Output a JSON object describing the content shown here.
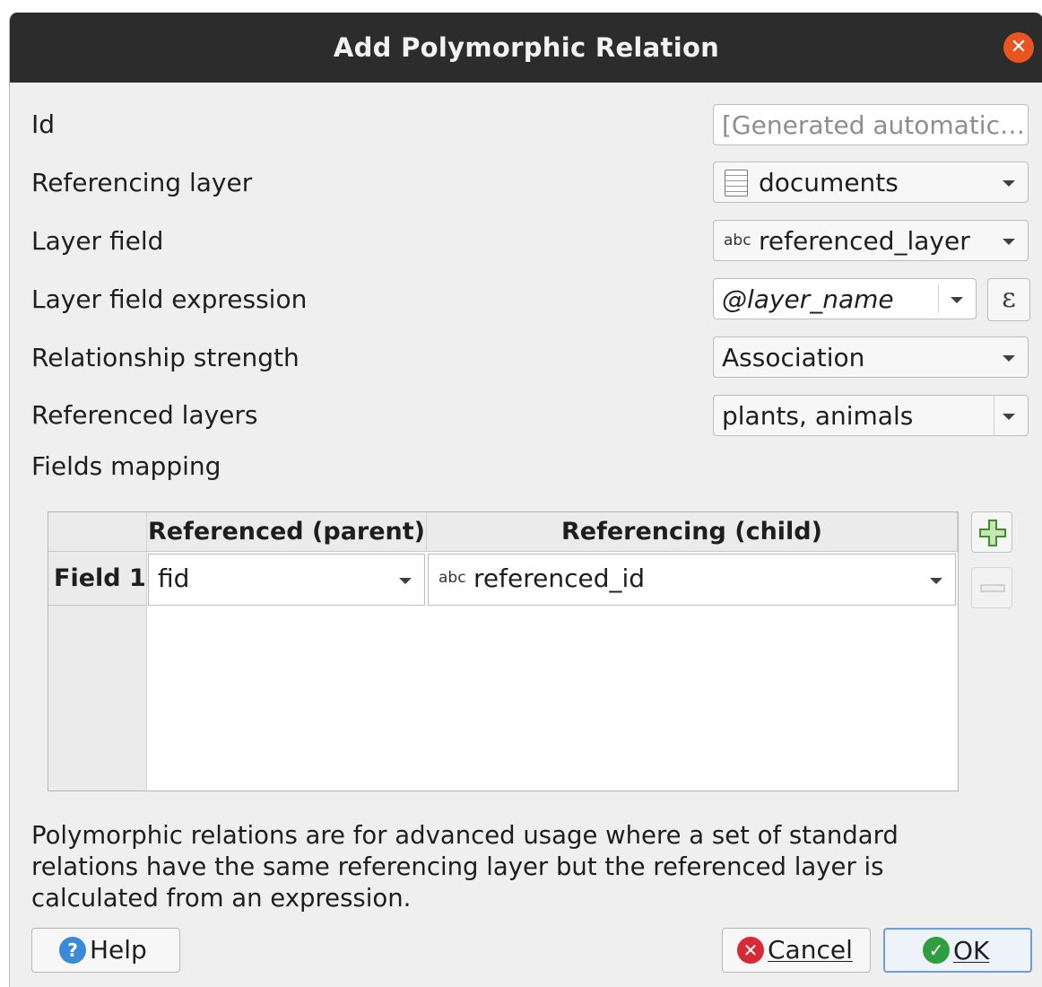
{
  "dialog": {
    "title": "Add Polymorphic Relation",
    "close_icon": "close-icon",
    "accent_color": "#e95420"
  },
  "form": {
    "id_label": "Id",
    "id_placeholder": "[Generated automatic…",
    "referencing_layer_label": "Referencing layer",
    "referencing_layer_value": "documents",
    "layer_field_label": "Layer field",
    "layer_field_type": "abc",
    "layer_field_value": "referenced_layer",
    "layer_field_expression_label": "Layer field expression",
    "layer_field_expression_value": "@layer_name",
    "expression_button_glyph": "ε",
    "relationship_strength_label": "Relationship strength",
    "relationship_strength_value": "Association",
    "referenced_layers_label": "Referenced layers",
    "referenced_layers_value": "plants, animals",
    "fields_mapping_label": "Fields mapping"
  },
  "mapping_table": {
    "columns": [
      "Referenced (parent)",
      "Referencing (child)"
    ],
    "rows": [
      {
        "header": "Field 1",
        "parent": "fid",
        "child_type": "abc",
        "child": "referenced_id"
      }
    ],
    "add_icon": "plus-icon",
    "remove_icon": "minus-icon"
  },
  "description": "Polymorphic relations are for advanced usage where a set of standard relations have the same referencing layer but the referenced layer is calculated from an expression.",
  "buttons": {
    "help": "Help",
    "cancel": "Cancel",
    "ok": "OK"
  }
}
